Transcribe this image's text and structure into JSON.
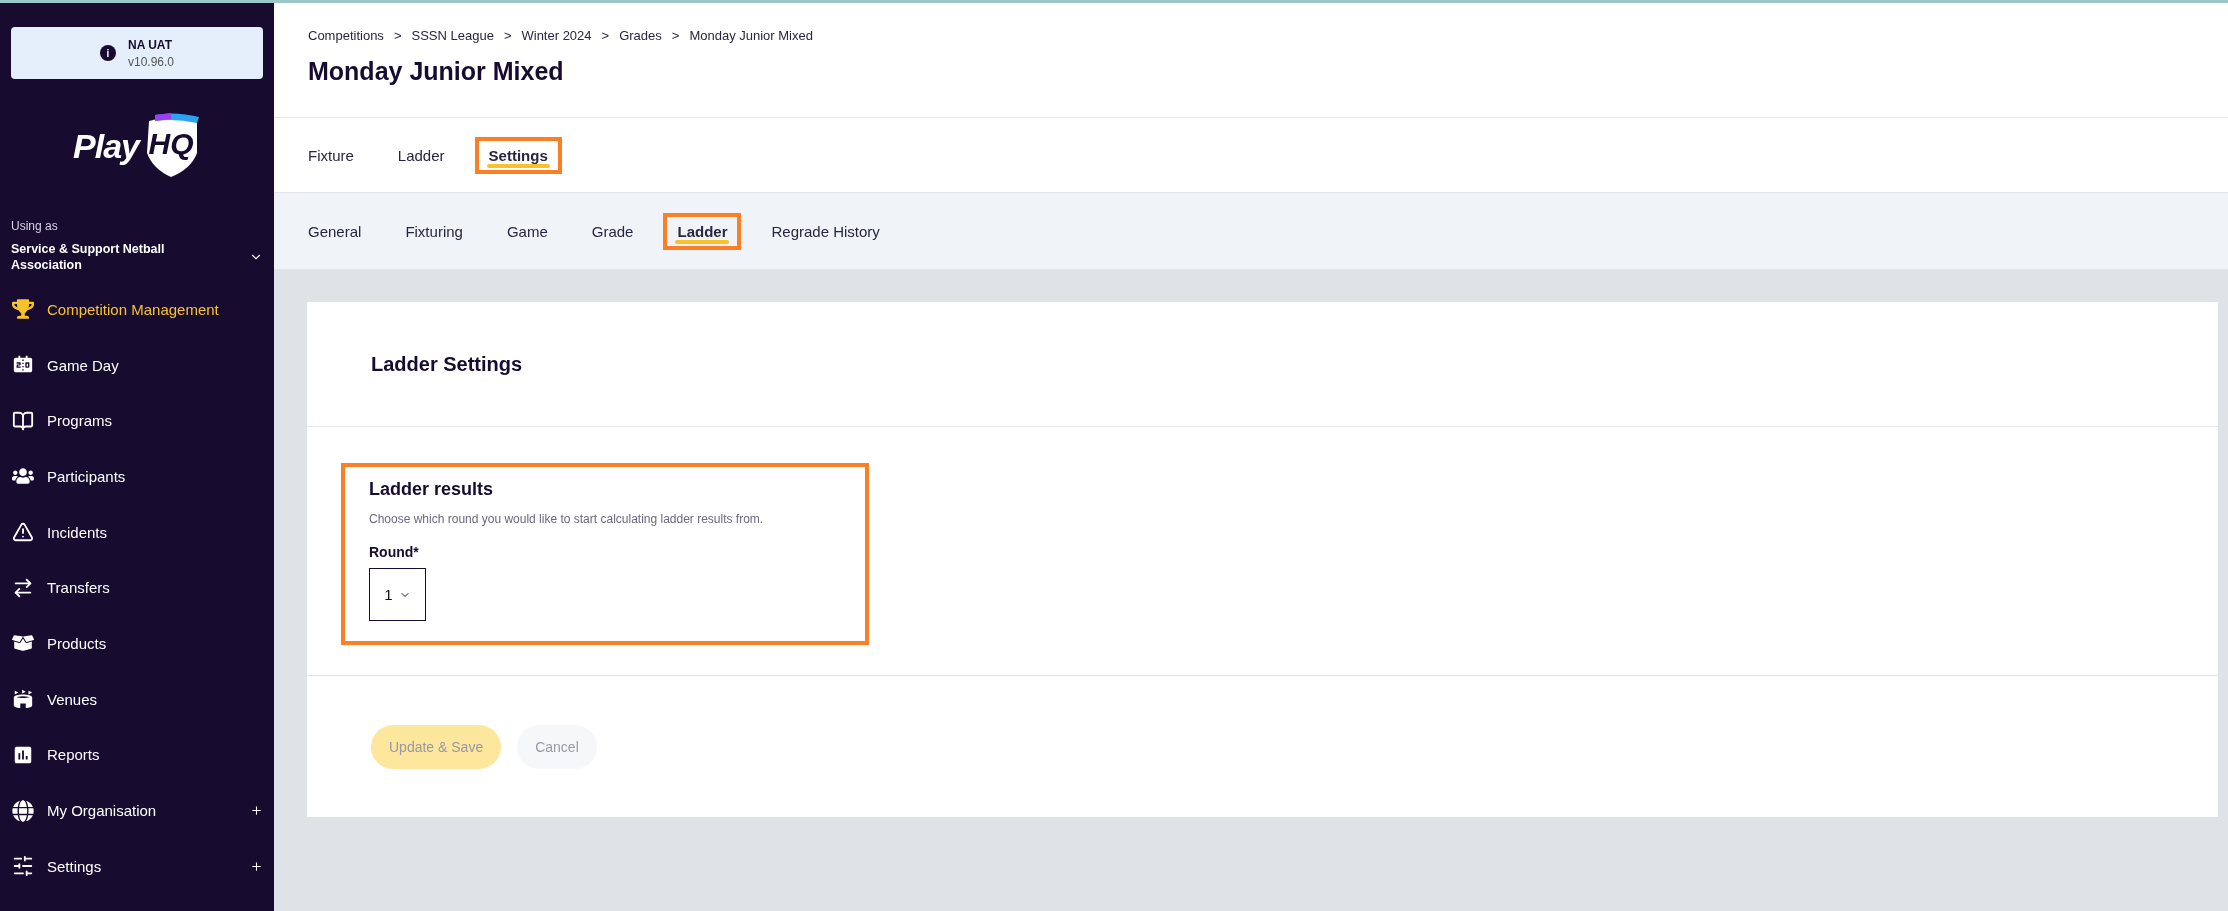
{
  "environment": {
    "name": "NA UAT",
    "version": "v10.96.0",
    "info_icon": "i"
  },
  "logo": {
    "word": "Play",
    "mark": "HQ"
  },
  "account": {
    "label": "Using as",
    "organisation": "Service & Support Netball Association"
  },
  "sidebar": {
    "items": [
      {
        "label": "Competition Management",
        "selected": true,
        "expandable": false
      },
      {
        "label": "Game Day",
        "selected": false,
        "expandable": false
      },
      {
        "label": "Programs",
        "selected": false,
        "expandable": false
      },
      {
        "label": "Participants",
        "selected": false,
        "expandable": false
      },
      {
        "label": "Incidents",
        "selected": false,
        "expandable": false
      },
      {
        "label": "Transfers",
        "selected": false,
        "expandable": false
      },
      {
        "label": "Products",
        "selected": false,
        "expandable": false
      },
      {
        "label": "Venues",
        "selected": false,
        "expandable": false
      },
      {
        "label": "Reports",
        "selected": false,
        "expandable": false
      },
      {
        "label": "My Organisation",
        "selected": false,
        "expandable": true
      },
      {
        "label": "Settings",
        "selected": false,
        "expandable": true
      }
    ]
  },
  "breadcrumb": [
    "Competitions",
    "SSSN League",
    "Winter 2024",
    "Grades",
    "Monday Junior Mixed"
  ],
  "breadcrumb_separator": ">",
  "page_title": "Monday Junior Mixed",
  "tabs": [
    {
      "label": "Fixture",
      "selected": false,
      "highlighted": false
    },
    {
      "label": "Ladder",
      "selected": false,
      "highlighted": false
    },
    {
      "label": "Settings",
      "selected": true,
      "highlighted": true
    }
  ],
  "sub_tabs": [
    {
      "label": "General",
      "selected": false,
      "highlighted": false
    },
    {
      "label": "Fixturing",
      "selected": false,
      "highlighted": false
    },
    {
      "label": "Game",
      "selected": false,
      "highlighted": false
    },
    {
      "label": "Grade",
      "selected": false,
      "highlighted": false
    },
    {
      "label": "Ladder",
      "selected": true,
      "highlighted": true
    },
    {
      "label": "Regrade History",
      "selected": false,
      "highlighted": false
    }
  ],
  "card": {
    "title": "Ladder Settings",
    "section": {
      "title": "Ladder results",
      "highlighted": true,
      "description": "Choose which round you would like to start calculating ladder results from.",
      "field_label": "Round*",
      "select_value": "1"
    },
    "buttons": [
      {
        "label": "Update & Save",
        "kind": "primary",
        "disabled": true
      },
      {
        "label": "Cancel",
        "kind": "secondary",
        "disabled": true
      }
    ]
  }
}
